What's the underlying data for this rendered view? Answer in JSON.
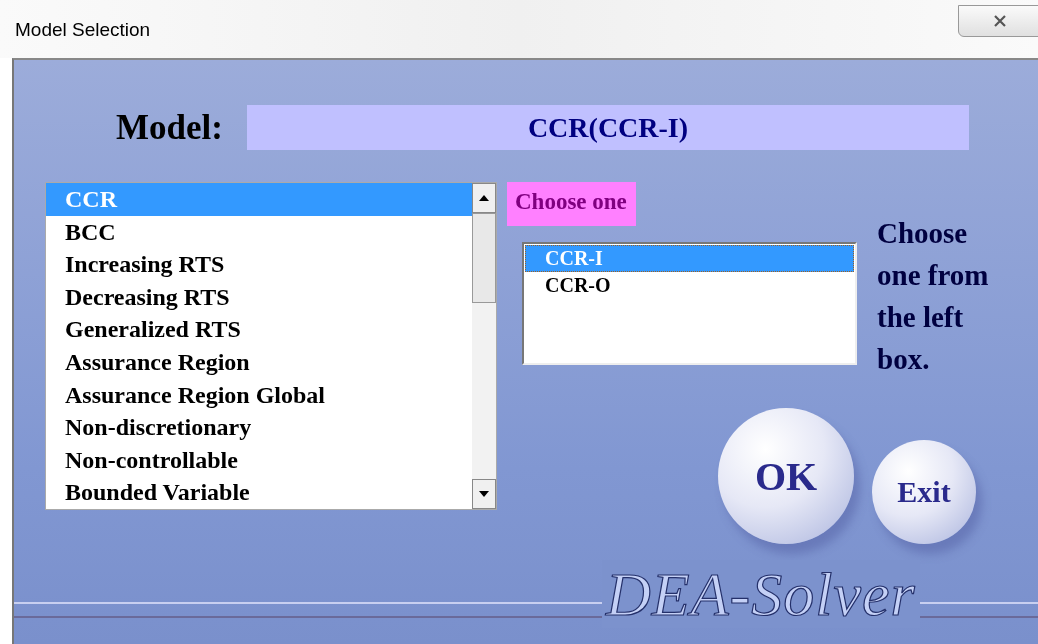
{
  "window": {
    "title": "Model Selection"
  },
  "model": {
    "label": "Model:",
    "value": "CCR(CCR-I)"
  },
  "models": [
    {
      "label": "CCR",
      "selected": true
    },
    {
      "label": "BCC",
      "selected": false
    },
    {
      "label": "Increasing RTS",
      "selected": false
    },
    {
      "label": "Decreasing RTS",
      "selected": false
    },
    {
      "label": "Generalized RTS",
      "selected": false
    },
    {
      "label": "Assurance Region",
      "selected": false
    },
    {
      "label": "Assurance Region Global",
      "selected": false
    },
    {
      "label": "Non-discretionary",
      "selected": false
    },
    {
      "label": "Non-controllable",
      "selected": false
    },
    {
      "label": "Bounded Variable",
      "selected": false
    }
  ],
  "variant_prompt": "Choose one",
  "variants": [
    {
      "label": "CCR-I",
      "selected": true
    },
    {
      "label": "CCR-O",
      "selected": false
    }
  ],
  "hint": "Choose one from the left box.",
  "buttons": [
    {
      "label": "OK",
      "kind": "large"
    },
    {
      "label": "Exit",
      "kind": "small"
    }
  ],
  "logo": "DEA-Solver"
}
